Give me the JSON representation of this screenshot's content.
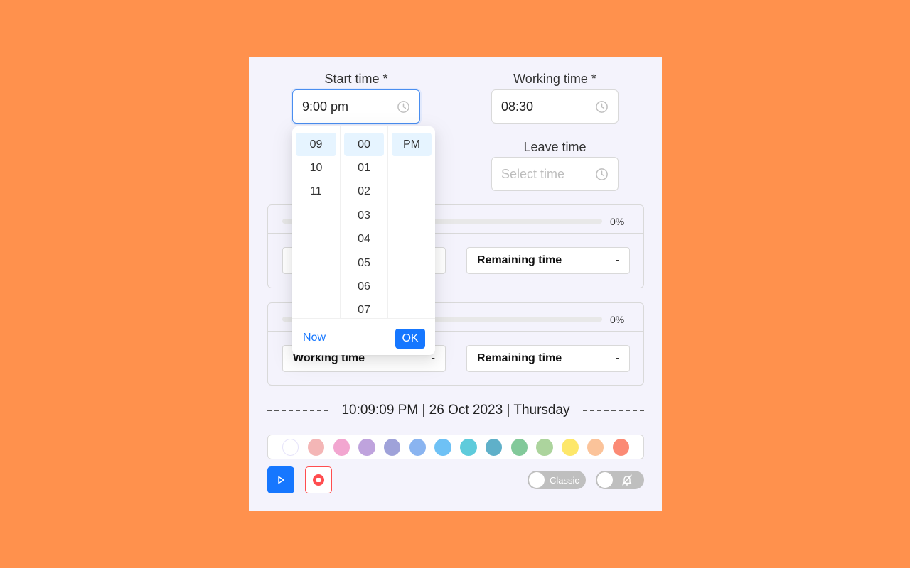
{
  "form": {
    "start_label": "Start time *",
    "start_value": "9:00 pm",
    "working_label": "Working time *",
    "working_value": "08:30",
    "leave_label": "Leave time",
    "leave_placeholder": "Select time"
  },
  "cards": [
    {
      "progress": 0,
      "progress_text": "0%",
      "left_box": {
        "label": "",
        "value": ""
      },
      "right_box": {
        "label": "Remaining time",
        "value": "-"
      }
    },
    {
      "progress": 0,
      "progress_text": "0%",
      "left_box": {
        "label": "Working time",
        "value": "-"
      },
      "right_box": {
        "label": "Remaining time",
        "value": "-"
      }
    }
  ],
  "clock": {
    "text": "10:09:09 PM | 26 Oct 2023 | Thursday"
  },
  "palette": {
    "colors": [
      "#ffffff",
      "#f4b6b6",
      "#f2a6d0",
      "#bfa3dd",
      "#9fa2d9",
      "#8ab4f0",
      "#6ec1f5",
      "#5ecbdb",
      "#5fb0c9",
      "#82c99a",
      "#acd49d",
      "#fde76a",
      "#fbc39a",
      "#fb8a75"
    ],
    "selected_index": 0
  },
  "controls": {
    "play_icon": "play-icon",
    "stop_icon": "stop-record-icon",
    "classic_toggle_label": "Classic",
    "classic_toggle_on": false,
    "sound_toggle_icon": "bell-slash-icon",
    "sound_toggle_on": false
  },
  "picker": {
    "hours": [
      "09",
      "10",
      "11"
    ],
    "minutes": [
      "00",
      "01",
      "02",
      "03",
      "04",
      "05",
      "06",
      "07"
    ],
    "periods": [
      "PM"
    ],
    "selected_hour": "09",
    "selected_minute": "00",
    "selected_period": "PM",
    "now_label": "Now",
    "ok_label": "OK"
  }
}
